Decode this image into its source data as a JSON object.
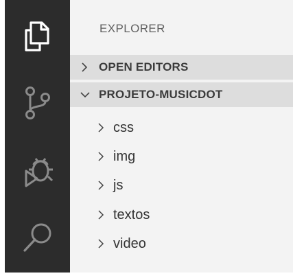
{
  "theme": {
    "activity_bar_bg": "#2c2c2c",
    "activity_icon_active": "#ffffff",
    "activity_icon_inactive": "#8b8b8b",
    "sidebar_bg": "#f3f3f3",
    "section_header_bg": "#dddddd",
    "text_color": "#333333"
  },
  "activity_bar": {
    "items": [
      {
        "icon": "files-icon",
        "active": true
      },
      {
        "icon": "source-control-icon",
        "active": false
      },
      {
        "icon": "debug-icon",
        "active": false
      },
      {
        "icon": "search-icon",
        "active": false
      }
    ]
  },
  "sidebar": {
    "title": "EXPLORER",
    "sections": [
      {
        "label": "OPEN EDITORS",
        "expanded": false
      },
      {
        "label": "PROJETO-MUSICDOT",
        "expanded": true
      }
    ],
    "folders": [
      {
        "label": "css",
        "expanded": false
      },
      {
        "label": "img",
        "expanded": false
      },
      {
        "label": "js",
        "expanded": false
      },
      {
        "label": "textos",
        "expanded": false
      },
      {
        "label": "video",
        "expanded": false
      }
    ]
  }
}
